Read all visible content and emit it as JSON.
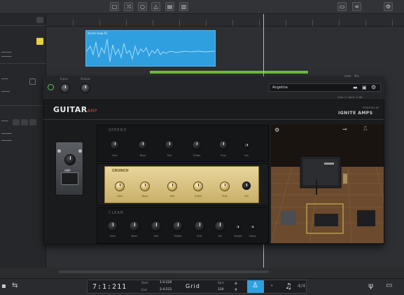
{
  "ruler": {
    "marks": [
      "",
      "",
      "",
      "",
      "",
      "",
      "",
      "",
      "",
      "",
      "",
      "",
      ""
    ]
  },
  "clip": {
    "title": "drums loop 01"
  },
  "plugin": {
    "preset_name": "Angelina",
    "preset_sub": "Gain: 0, Input: 2 dBu",
    "logo_main": "GUITAR",
    "logo_sub": "AMP",
    "brand": "IGNITE AMPS",
    "powered_by": "POWERED BY",
    "top_knob_labels": [
      "Input",
      "Output"
    ],
    "top_right_labels": [
      "Gate",
      "Mix"
    ],
    "amp1_name": "SPEEDO",
    "amp2_name": "CRUNCH",
    "amp3_name": "CLEAN",
    "amp1_labels": [
      "Gain",
      "Bass",
      "Mid",
      "Treble",
      "Pres",
      "Vol"
    ],
    "amp2_labels": [
      "Gain",
      "Bass",
      "Mid",
      "Treble",
      "Pres",
      "Vol",
      "On"
    ],
    "amp3_labels": [
      "Gain",
      "Bass",
      "Mid",
      "Treble",
      "Pres",
      "Vol",
      "Bright",
      "Deep"
    ],
    "pedal_label": "AMP"
  },
  "transport": {
    "position": "7:1:211",
    "start_label": "Start",
    "start_value": "1:0:226",
    "end_label": "End",
    "end_value": "2:4:211",
    "grid_label": "Grid",
    "bpm_label": "Bpm",
    "bpm_value": "120",
    "time_sig_label": "4/4"
  },
  "colors": {
    "accent": "#2f9fe0",
    "region": "#6cbc3e",
    "plugin_gold": "#d8c27e",
    "status_yellow": "#e6d23a"
  }
}
